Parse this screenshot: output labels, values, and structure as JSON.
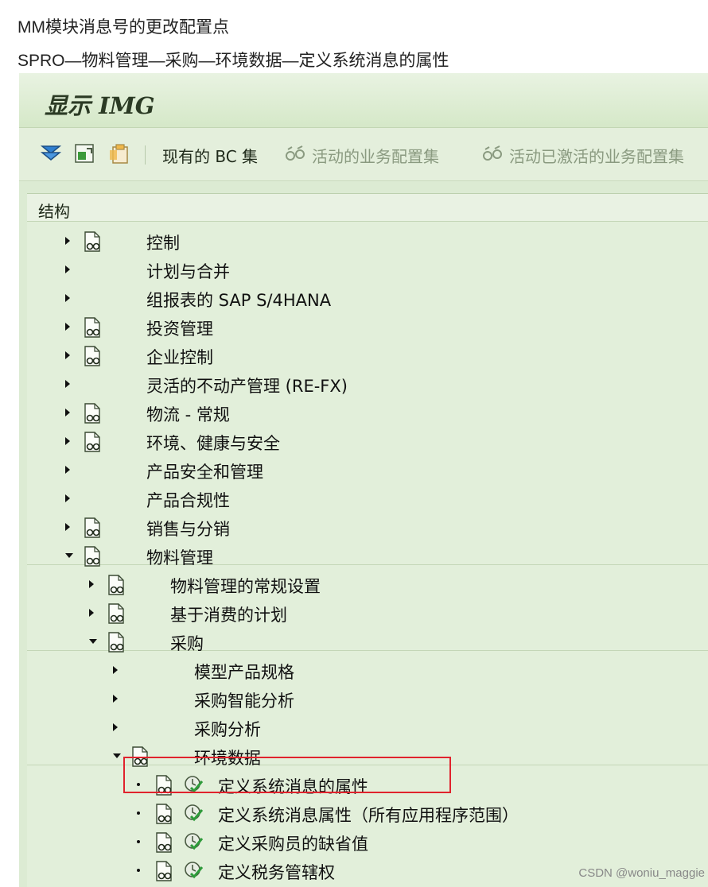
{
  "intro": {
    "line1": "MM模块消息号的更改配置点",
    "line2": "SPRO—物料管理—采购—环境数据—定义系统消息的属性"
  },
  "window": {
    "title": "显示 IMG"
  },
  "toolbar": {
    "icons": [
      "expand-icon",
      "find-icon",
      "clipboard-icon"
    ],
    "current_bc_set": "现有的 BC 集",
    "active_business_config_set": "活动的业务配置集",
    "activated_business_config_set": "活动已激活的业务配置集"
  },
  "structure": {
    "header": "结构",
    "level1": [
      {
        "label": "控制",
        "expand": "collapsed",
        "has_doc": true
      },
      {
        "label": "计划与合并",
        "expand": "collapsed",
        "has_doc": false
      },
      {
        "label": "组报表的 SAP S/4HANA",
        "expand": "collapsed",
        "has_doc": false
      },
      {
        "label": "投资管理",
        "expand": "collapsed",
        "has_doc": true
      },
      {
        "label": "企业控制",
        "expand": "collapsed",
        "has_doc": true
      },
      {
        "label": "灵活的不动产管理 (RE-FX)",
        "expand": "collapsed",
        "has_doc": false
      },
      {
        "label": "物流 - 常规",
        "expand": "collapsed",
        "has_doc": true
      },
      {
        "label": "环境、健康与安全",
        "expand": "collapsed",
        "has_doc": true
      },
      {
        "label": "产品安全和管理",
        "expand": "collapsed",
        "has_doc": false
      },
      {
        "label": "产品合规性",
        "expand": "collapsed",
        "has_doc": false
      },
      {
        "label": "销售与分销",
        "expand": "collapsed",
        "has_doc": true
      },
      {
        "label": "物料管理",
        "expand": "expanded",
        "has_doc": true
      }
    ],
    "level2": [
      {
        "label": "物料管理的常规设置",
        "expand": "collapsed",
        "has_doc": true
      },
      {
        "label": "基于消费的计划",
        "expand": "collapsed",
        "has_doc": true
      },
      {
        "label": "采购",
        "expand": "expanded",
        "has_doc": true
      }
    ],
    "level3": [
      {
        "label": "模型产品规格",
        "expand": "collapsed",
        "has_doc": false
      },
      {
        "label": "采购智能分析",
        "expand": "collapsed",
        "has_doc": false
      },
      {
        "label": "采购分析",
        "expand": "collapsed",
        "has_doc": false
      },
      {
        "label": "环境数据",
        "expand": "expanded",
        "has_doc": true
      }
    ],
    "level4": [
      {
        "label": "定义系统消息的属性",
        "highlighted": true
      },
      {
        "label": "定义系统消息属性（所有应用程序范围）",
        "highlighted": false
      },
      {
        "label": "定义采购员的缺省值",
        "highlighted": false
      },
      {
        "label": "定义税务管辖权",
        "highlighted": false
      }
    ]
  },
  "watermark": "CSDN @woniu_maggie",
  "colors": {
    "highlight_border": "#e0232d",
    "panel_bg": "#e2efda",
    "title_bg": "#d5e8c8"
  }
}
